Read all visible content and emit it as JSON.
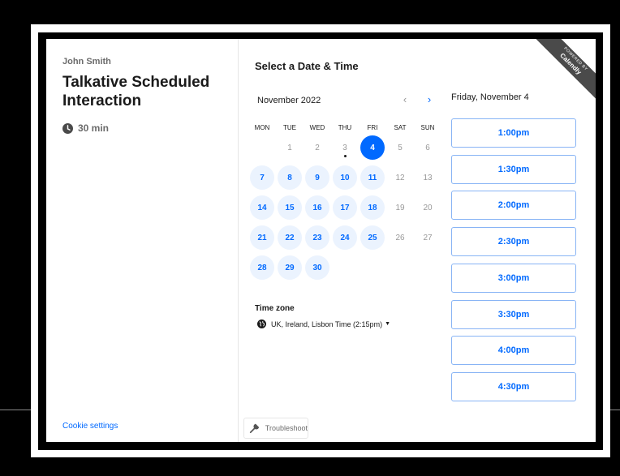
{
  "host": {
    "name": "John Smith"
  },
  "event": {
    "title": "Talkative Scheduled Interaction",
    "duration": "30 min"
  },
  "footer": {
    "cookie_settings": "Cookie settings",
    "troubleshoot": "Troubleshoot"
  },
  "calendar": {
    "heading": "Select a Date & Time",
    "month": "November 2022",
    "prev": "‹",
    "next": "›",
    "weekdays": [
      "MON",
      "TUE",
      "WED",
      "THU",
      "FRI",
      "SAT",
      "SUN"
    ],
    "days": [
      {
        "label": "1",
        "state": "unavail"
      },
      {
        "label": "2",
        "state": "unavail"
      },
      {
        "label": "3",
        "state": "today"
      },
      {
        "label": "4",
        "state": "selected"
      },
      {
        "label": "5",
        "state": "unavail"
      },
      {
        "label": "6",
        "state": "unavail"
      },
      {
        "label": "7",
        "state": "avail"
      },
      {
        "label": "8",
        "state": "avail"
      },
      {
        "label": "9",
        "state": "avail"
      },
      {
        "label": "10",
        "state": "avail"
      },
      {
        "label": "11",
        "state": "avail"
      },
      {
        "label": "12",
        "state": "unavail"
      },
      {
        "label": "13",
        "state": "unavail"
      },
      {
        "label": "14",
        "state": "avail"
      },
      {
        "label": "15",
        "state": "avail"
      },
      {
        "label": "16",
        "state": "avail"
      },
      {
        "label": "17",
        "state": "avail"
      },
      {
        "label": "18",
        "state": "avail"
      },
      {
        "label": "19",
        "state": "unavail"
      },
      {
        "label": "20",
        "state": "unavail"
      },
      {
        "label": "21",
        "state": "avail"
      },
      {
        "label": "22",
        "state": "avail"
      },
      {
        "label": "23",
        "state": "avail"
      },
      {
        "label": "24",
        "state": "avail"
      },
      {
        "label": "25",
        "state": "avail"
      },
      {
        "label": "26",
        "state": "unavail"
      },
      {
        "label": "27",
        "state": "unavail"
      },
      {
        "label": "28",
        "state": "avail"
      },
      {
        "label": "29",
        "state": "avail"
      },
      {
        "label": "30",
        "state": "avail"
      }
    ],
    "first_weekday": "TUE"
  },
  "timezone": {
    "label": "Time zone",
    "value": "UK, Ireland, Lisbon Time (2:15pm)"
  },
  "times": {
    "date": "Friday, November 4",
    "slots": [
      "1:00pm",
      "1:30pm",
      "2:00pm",
      "2:30pm",
      "3:00pm",
      "3:30pm",
      "4:00pm",
      "4:30pm"
    ]
  },
  "badge": {
    "line1": "POWERED BY",
    "line2": "Calendly"
  },
  "icons": {
    "duration": "clock-icon",
    "timezone": "globe-icon",
    "troubleshoot": "wrench-icon"
  },
  "colors": {
    "accent": "#0069ff",
    "available_bg": "#ebf3fe",
    "border": "#88b4f5"
  }
}
